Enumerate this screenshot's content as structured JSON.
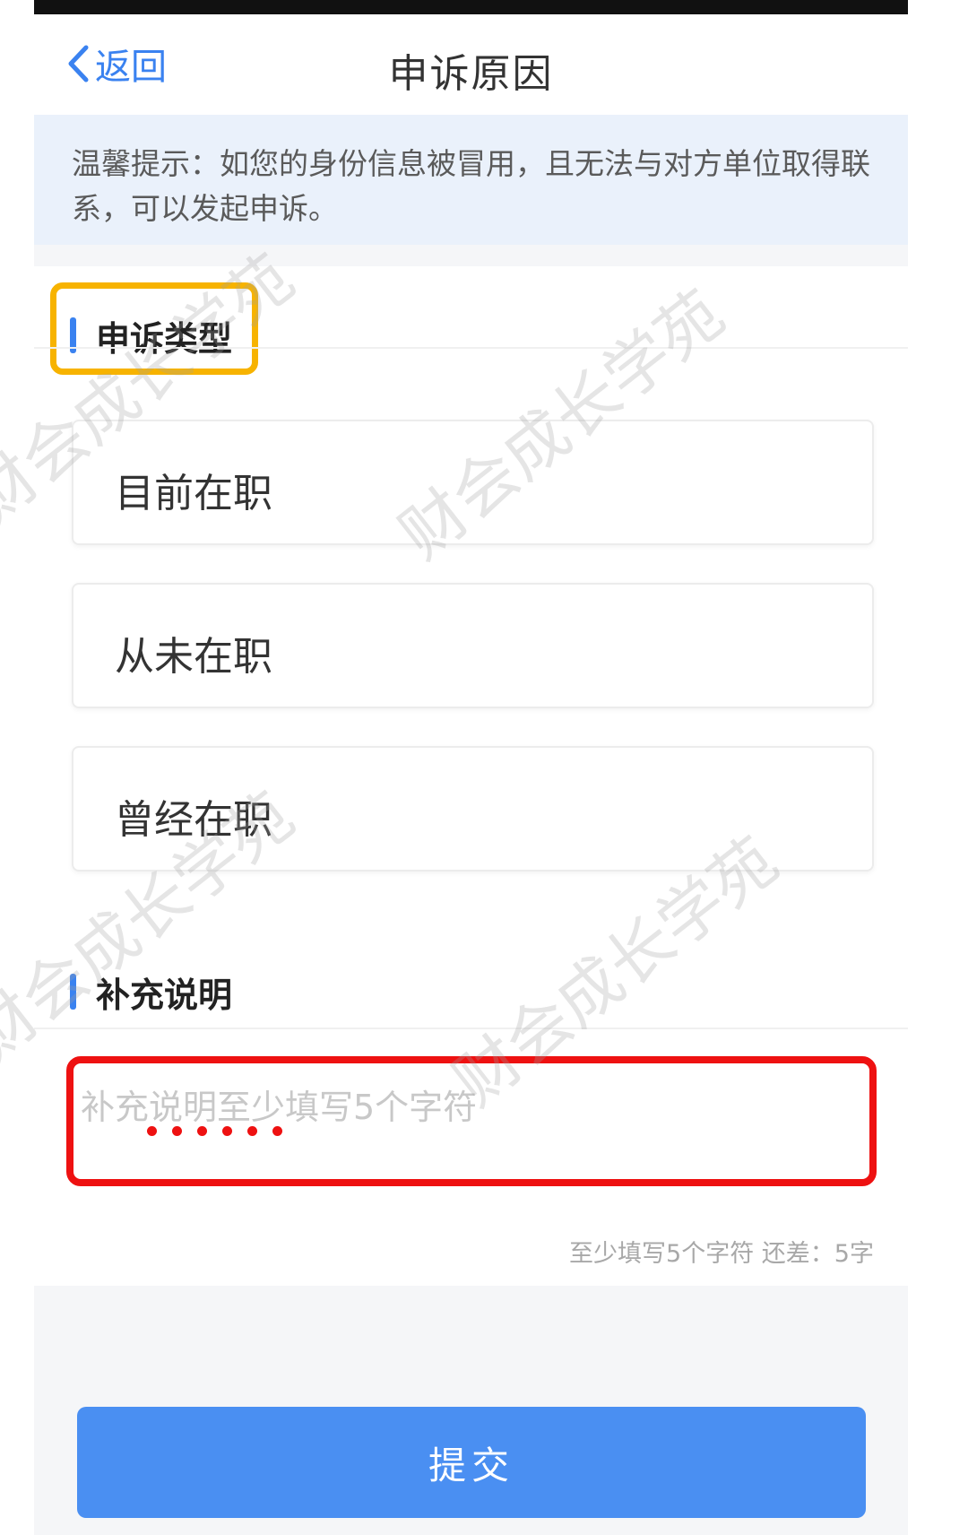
{
  "nav": {
    "back_label": "返回",
    "title": "申诉原因"
  },
  "notice": {
    "text": "温馨提示：如您的身份信息被冒用，且无法与对方单位取得联系，可以发起申诉。"
  },
  "appeal_type": {
    "heading": "申诉类型",
    "options": [
      "目前在职",
      "从未在职",
      "曾经在职"
    ]
  },
  "supplement": {
    "heading": "补充说明",
    "placeholder": "补充说明至少填写5个字符",
    "counter": "至少填写5个字符 还差：5字"
  },
  "submit_label": "提交",
  "watermark_text": "财会成长学苑",
  "colors": {
    "accent": "#3a82f0",
    "button": "#4a8ff2",
    "highlight_orange": "#f7b300",
    "highlight_red": "#ee1111"
  }
}
